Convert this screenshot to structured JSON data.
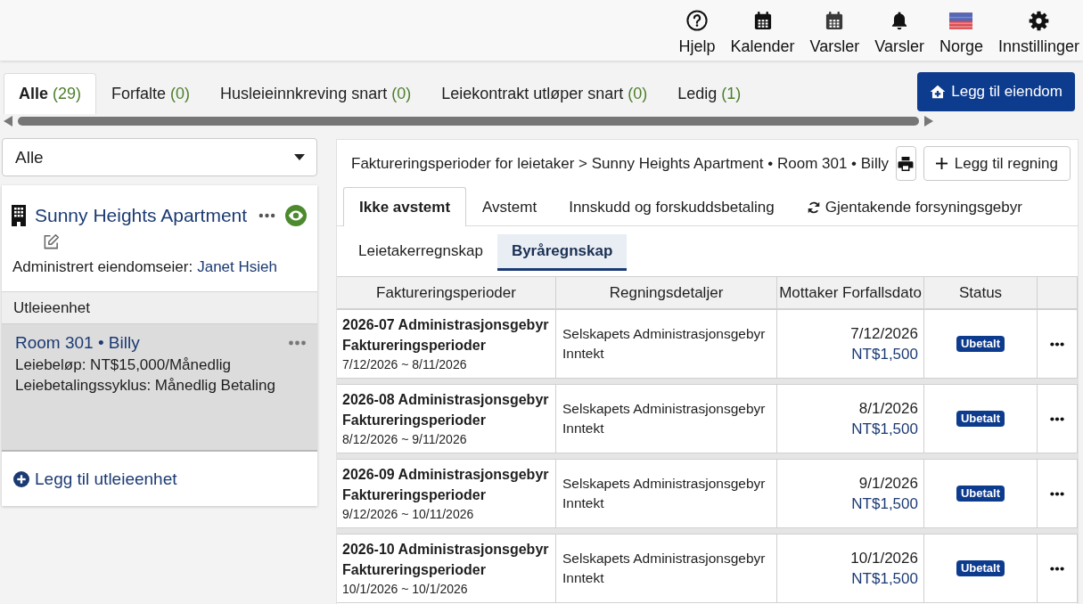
{
  "top_nav": [
    {
      "label": "Hjelp"
    },
    {
      "label": "Kalender"
    },
    {
      "label": "Varsler"
    },
    {
      "label": "Varsler"
    },
    {
      "label": "Norge"
    },
    {
      "label": "Innstillinger"
    }
  ],
  "filter_tabs": [
    {
      "label": "Alle",
      "count": "(29)",
      "selected": true
    },
    {
      "label": "Forfalte",
      "count": "(0)",
      "selected": false
    },
    {
      "label": "Husleieinnkreving snart",
      "count": "(0)",
      "selected": false
    },
    {
      "label": "Leiekontrakt utløper snart",
      "count": "(0)",
      "selected": false
    },
    {
      "label": "Ledig",
      "count": "(1)",
      "selected": false
    }
  ],
  "add_property_button": {
    "label": "Legg til eiendom"
  },
  "property_filter": {
    "value": "Alle"
  },
  "property_card": {
    "title": "Sunny Heights Apartment",
    "owner_label": "Administrert eiendomseier:",
    "owner_name": "Janet Hsieh",
    "units_heading": "Utleieenhet",
    "units": [
      {
        "name": "Room 301 • Billy",
        "rent": "Leiebeløp: NT$15,000/Månedlig",
        "cycle": "Leiebetalingssyklus: Månedlig Betaling",
        "selected": true
      }
    ],
    "add_unit": "Legg til utleieenhet"
  },
  "billing_panel": {
    "breadcrumb": "Faktureringsperioder for leietaker > Sunny Heights Apartment • Room 301 • Billy",
    "add_bill_button": "Legg til regning",
    "tabs": [
      {
        "label": "Ikke avstemt",
        "kind": "plain",
        "selected": true
      },
      {
        "label": "Avstemt",
        "kind": "plain",
        "selected": false
      },
      {
        "label": "Innskudd og forskuddsbetaling",
        "kind": "plain",
        "selected": false
      },
      {
        "label": "Gjentakende forsyningsgebyr",
        "kind": "recurring",
        "selected": false
      }
    ],
    "subtabs": [
      {
        "label": "Leietakerregnskap",
        "selected": false
      },
      {
        "label": "Byråregnskap",
        "selected": true
      }
    ],
    "table": {
      "columns": [
        "Faktureringsperioder",
        "Regningsdetaljer",
        "Mottaker Forfallsdato",
        "Status"
      ],
      "rows": [
        {
          "title": "2026-07 Administrasjonsgebyr Faktureringsperioder",
          "period": "7/12/2026 ~ 8/11/2026",
          "details": "Selskapets Administrasjonsgebyr Inntekt",
          "due_date": "7/12/2026",
          "amount": "NT$1,500",
          "status": "Ubetalt"
        },
        {
          "title": "2026-08 Administrasjonsgebyr Faktureringsperioder",
          "period": "8/12/2026 ~ 9/11/2026",
          "details": "Selskapets Administrasjonsgebyr Inntekt",
          "due_date": "8/1/2026",
          "amount": "NT$1,500",
          "status": "Ubetalt"
        },
        {
          "title": "2026-09 Administrasjonsgebyr Faktureringsperioder",
          "period": "9/12/2026 ~ 10/11/2026",
          "details": "Selskapets Administrasjonsgebyr Inntekt",
          "due_date": "9/1/2026",
          "amount": "NT$1,500",
          "status": "Ubetalt"
        },
        {
          "title": "2026-10 Administrasjonsgebyr Faktureringsperioder",
          "period": "10/1/2026 ~ 10/1/2026",
          "details": "Selskapets Administrasjonsgebyr Inntekt",
          "due_date": "10/1/2026",
          "amount": "NT$1,500",
          "status": "Ubetalt"
        }
      ]
    }
  }
}
